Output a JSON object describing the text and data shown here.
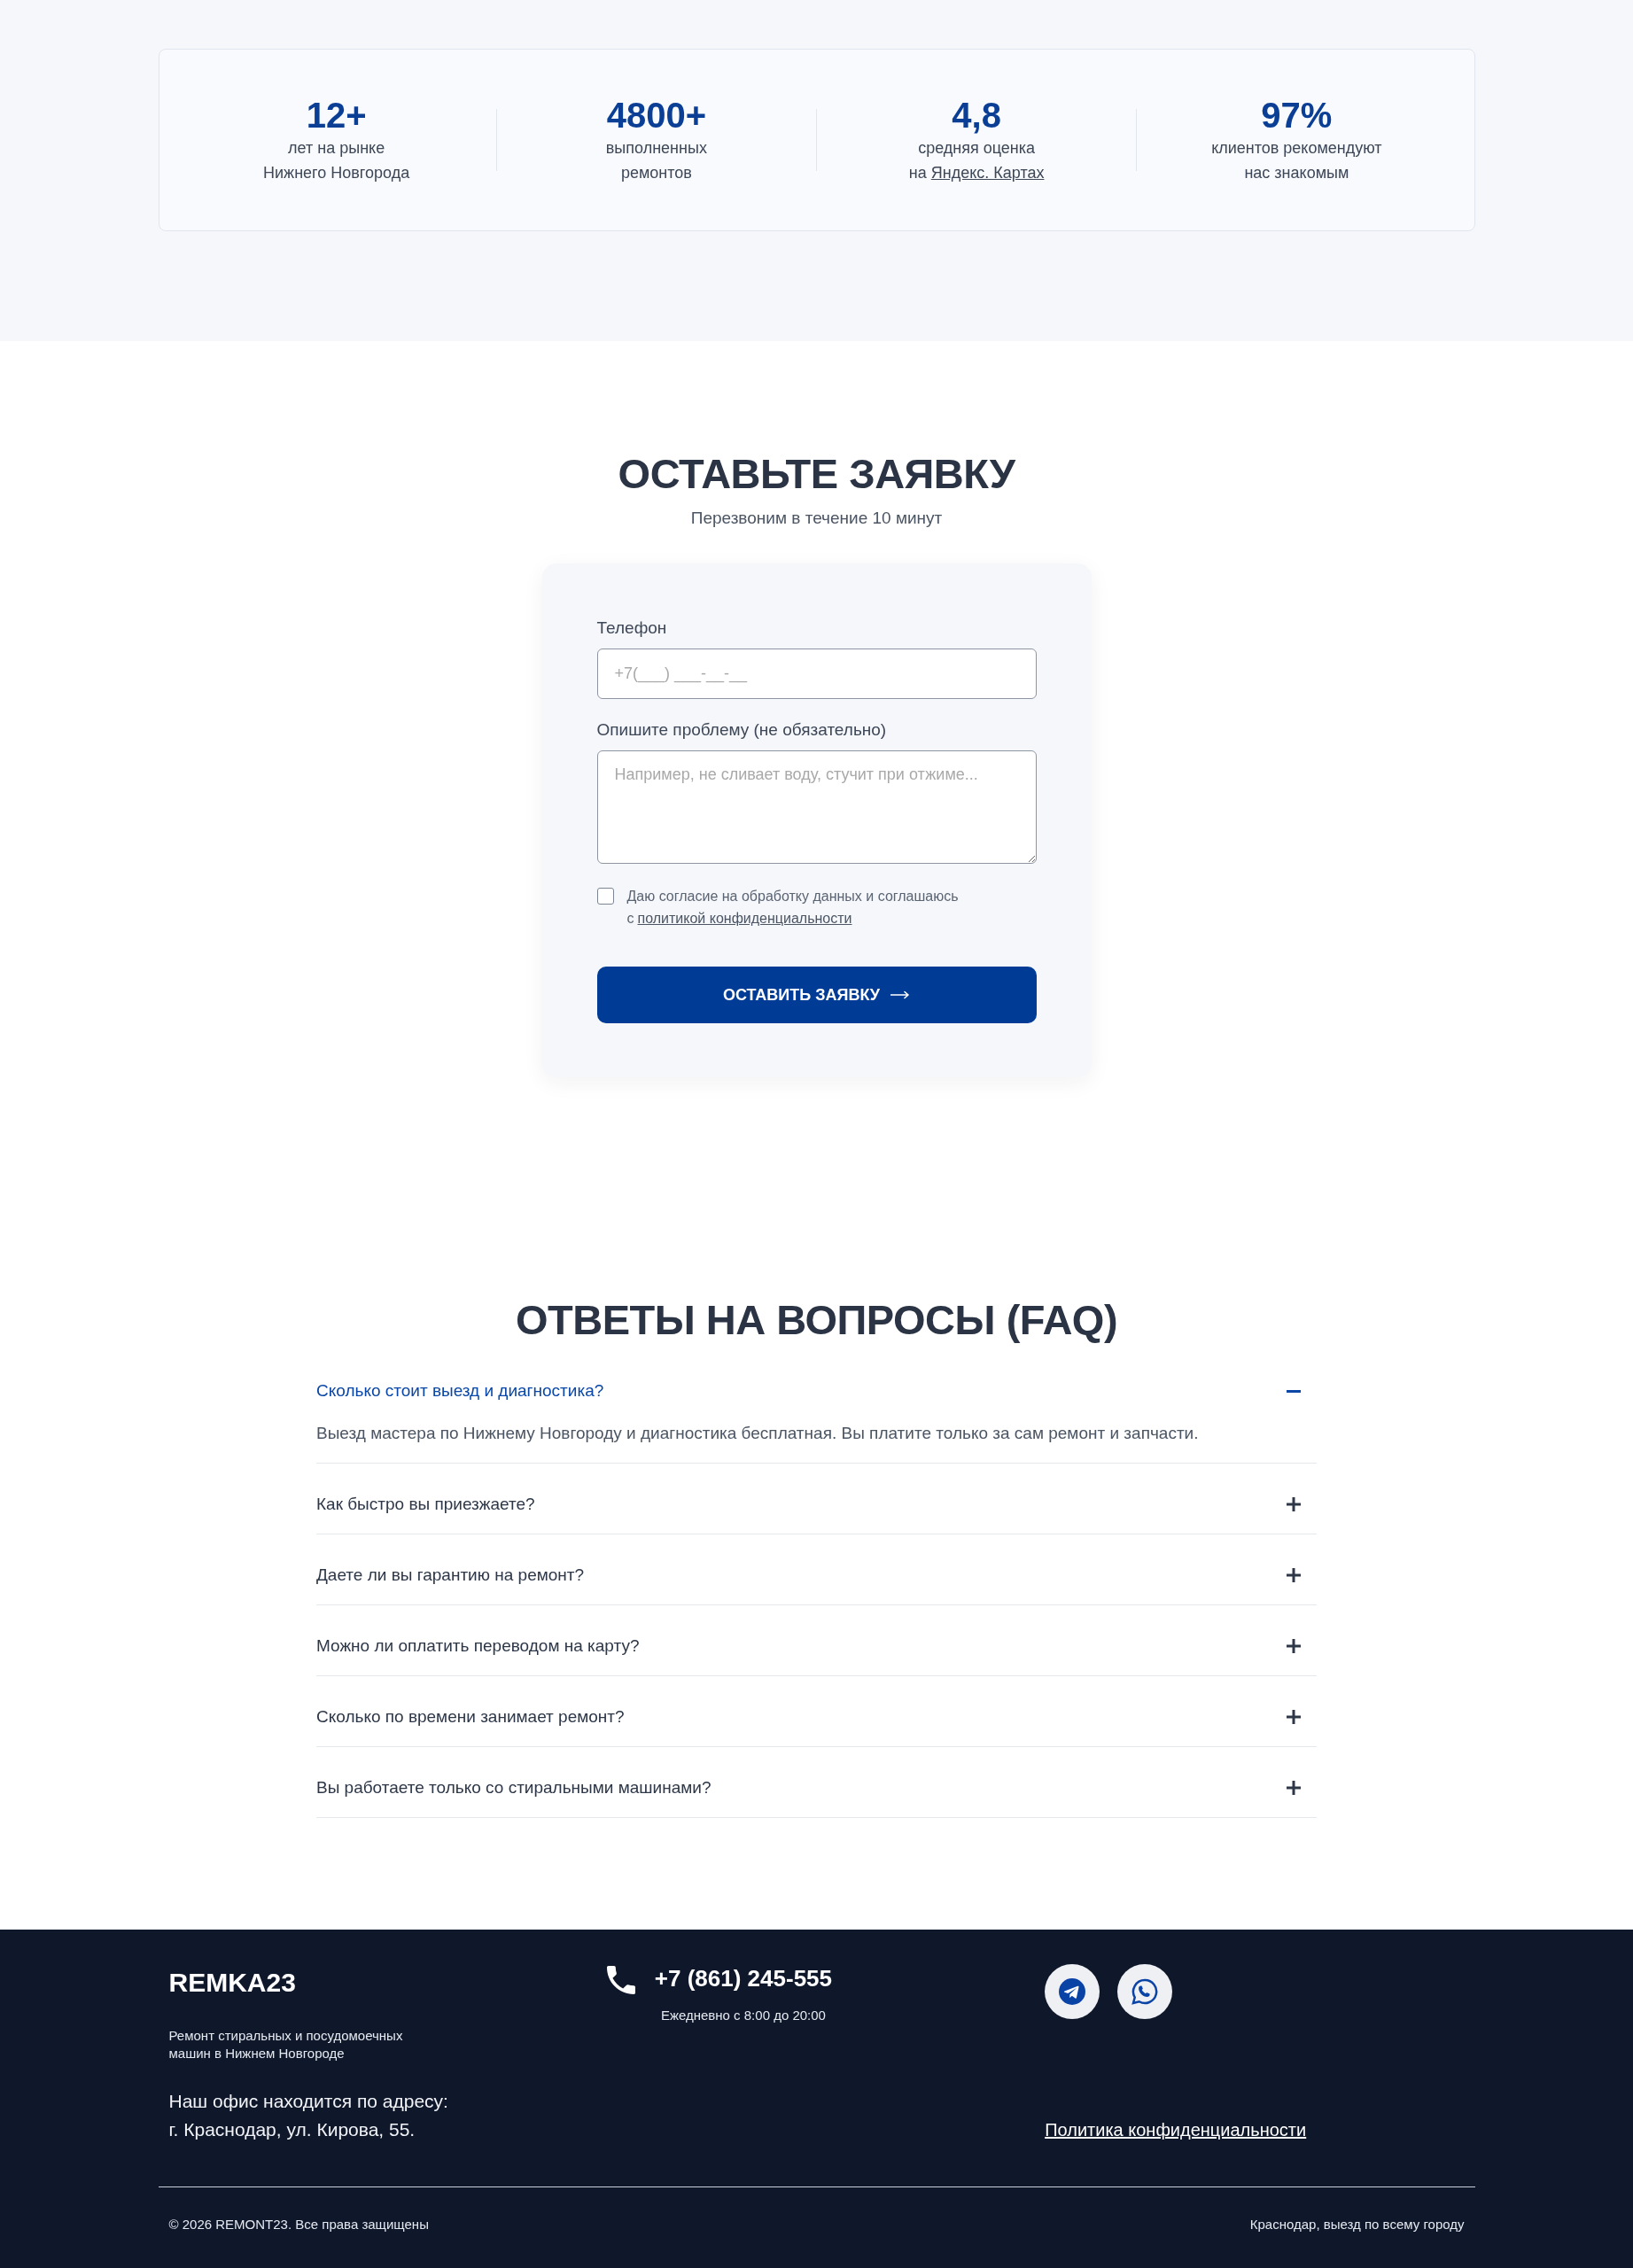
{
  "stats": [
    {
      "value": "12+",
      "label": "лет на рынке\nНижнего Новгорода"
    },
    {
      "value": "4800+",
      "label": "выполненных\nремонтов"
    },
    {
      "value": "4,8",
      "label": "средняя оценка\nна",
      "link": "Яндекс. Картах"
    },
    {
      "value": "97%",
      "label": "клиентов рекомендуют\nнас знакомым"
    }
  ],
  "request_form": {
    "title": "ОСТАВЬТЕ ЗАЯВКУ",
    "subtitle": "Перезвоним в течение 10 минут",
    "fields": [
      {
        "kind": "input",
        "label": "Телефон",
        "placeholder": "+7(___) ___-__-__"
      },
      {
        "kind": "textarea",
        "label": "Опишите проблему (не обязательно)",
        "placeholder": "Например, не сливает воду, стучит при отжиме..."
      }
    ],
    "consent": {
      "checked": false,
      "text": "Даю согласие на обработку данных и соглашаюсь с",
      "link": "политикой конфиденциальности"
    },
    "submit": "ОСТАВИТЬ ЗАЯВКУ"
  },
  "faq": {
    "title": "ОТВЕТЫ НА ВОПРОСЫ (FAQ)",
    "items": [
      {
        "question": "Сколько стоит выезд и диагностика?",
        "answer": "Выезд мастера по Нижнему Новгороду и диагностика бесплатная. Вы платите только за сам ремонт и запчасти.",
        "expanded": true
      },
      {
        "question": "Как быстро вы приезжаете?",
        "expanded": false
      },
      {
        "question": "Даете ли вы гарантию на ремонт?",
        "expanded": false
      },
      {
        "question": "Можно ли оплатить переводом на карту?",
        "expanded": false
      },
      {
        "question": "Сколько по времени занимает ремонт?",
        "expanded": false
      },
      {
        "question": "Вы работаете только со стиральными машинами?",
        "expanded": false
      }
    ]
  },
  "footer": {
    "logo": "REMKA23",
    "description": "Ремонт стиральных и посудомоечных\nмашин в Нижнем Новгороде",
    "address": "Наш офис находится по адресу:\nг. Краснодар, ул. Кирова, 55.",
    "phone": "+7 (861) 245-555",
    "hours": "Ежедневно с 8:00 до 20:00",
    "social": [
      {
        "kind": "telegram"
      },
      {
        "kind": "whatsapp"
      }
    ],
    "privacy_link": "Политика конфиденциальности",
    "copyright": "© 2026 REMONT23. Все права защищены",
    "service_area": "Краснодар, выезд по всему городу"
  }
}
